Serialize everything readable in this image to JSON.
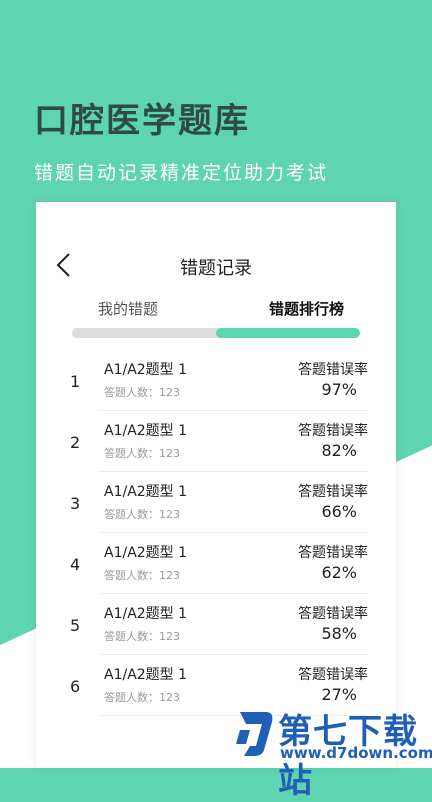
{
  "hero": {
    "title": "口腔医学题库",
    "subtitle": "错题自动记录精准定位助力考试"
  },
  "nav": {
    "title": "错题记录",
    "back_icon": "chevron-left-icon"
  },
  "tabs": [
    {
      "label": "我的错题",
      "active": false
    },
    {
      "label": "错题排行榜",
      "active": true
    }
  ],
  "progress": {
    "active_start_fraction": 0.5,
    "active_end_fraction": 1.0
  },
  "colors": {
    "accent": "#5fd4b1",
    "dark_title": "#2f4b45",
    "watermark": "#1f5fb8"
  },
  "list": {
    "rows": [
      {
        "rank": "1",
        "name": "A1/A2题型 1",
        "count_label": "答题人数：123",
        "rate_label": "答题错误率",
        "rate": "97%"
      },
      {
        "rank": "2",
        "name": "A1/A2题型 1",
        "count_label": "答题人数：123",
        "rate_label": "答题错误率",
        "rate": "82%"
      },
      {
        "rank": "3",
        "name": "A1/A2题型 1",
        "count_label": "答题人数：123",
        "rate_label": "答题错误率",
        "rate": "66%"
      },
      {
        "rank": "4",
        "name": "A1/A2题型 1",
        "count_label": "答题人数：123",
        "rate_label": "答题错误率",
        "rate": "62%"
      },
      {
        "rank": "5",
        "name": "A1/A2题型 1",
        "count_label": "答题人数：123",
        "rate_label": "答题错误率",
        "rate": "58%"
      },
      {
        "rank": "6",
        "name": "A1/A2题型 1",
        "count_label": "答题人数：123",
        "rate_label": "答题错误率",
        "rate": "27%"
      }
    ]
  },
  "watermark": {
    "text": "第七下载站",
    "url": "www.d7down.com"
  }
}
